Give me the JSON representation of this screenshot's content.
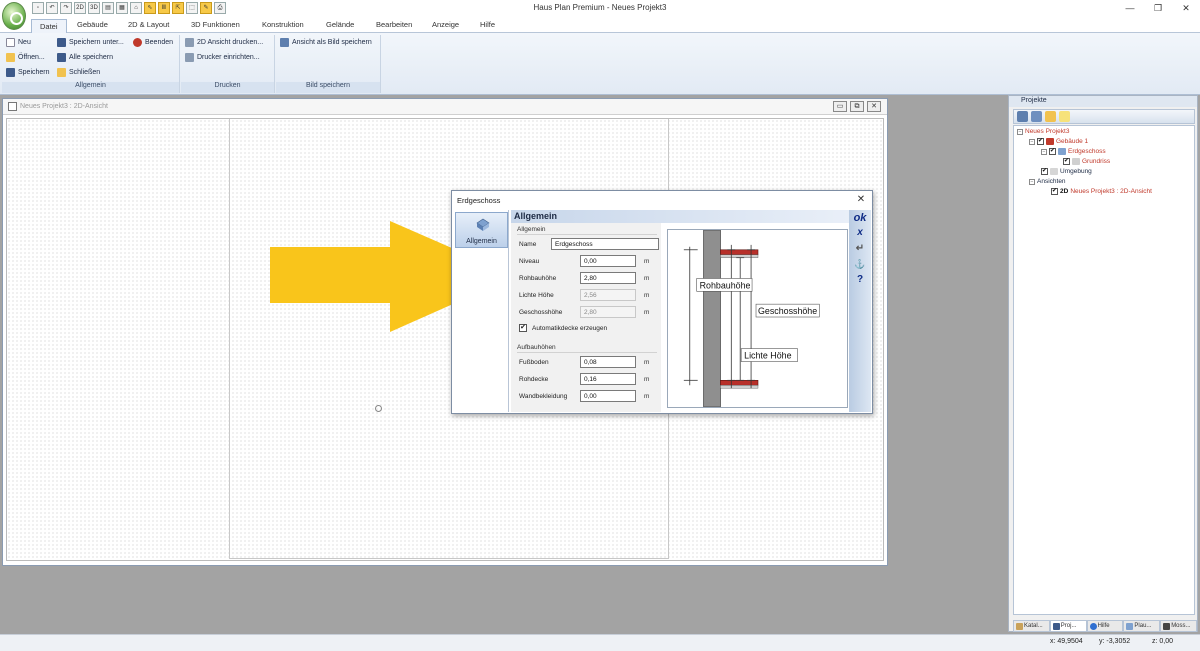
{
  "window": {
    "title": "Haus Plan Premium - Neues Projekt3",
    "controls": [
      "—",
      "❐",
      "✕"
    ]
  },
  "qat": [
    "2D",
    "3D",
    "▤",
    "▦",
    "⌂",
    "Ⅲ",
    "⇱",
    "⬚",
    "✎",
    "⎙"
  ],
  "ribbon": {
    "tabs": [
      "Datei",
      "Gebäude",
      "2D & Layout",
      "3D Funktionen",
      "Konstruktion",
      "Gelände",
      "Bearbeiten",
      "Anzeige",
      "Hilfe"
    ],
    "active_tab": "Datei",
    "groups": {
      "allgemein": {
        "label": "Allgemein",
        "items": [
          "Neu",
          "Öffnen...",
          "Speichern",
          "Speichern unter...",
          "Alle speichern",
          "Schließen",
          "Beenden"
        ]
      },
      "drucken": {
        "label": "Drucken",
        "items": [
          "2D Ansicht drucken...",
          "Drucker einrichten..."
        ]
      },
      "bild": {
        "label": "Bild speichern",
        "items": [
          "Ansicht als Bild speichern"
        ]
      }
    }
  },
  "view": {
    "title": "Neues Projekt3 : 2D-Ansicht",
    "controls": [
      "▭",
      "⧉",
      "✕"
    ]
  },
  "annotation": {
    "arrow_color": "#f9c51b"
  },
  "dialog": {
    "title": "Erdgeschoss",
    "close": "✕",
    "sidebar_item": "Allgemein",
    "header": "Allgemein",
    "section1": "Allgemein",
    "section2": "Aufbauhöhen",
    "fields": {
      "name": {
        "label": "Name",
        "value": "Erdgeschoss"
      },
      "niveau": {
        "label": "Niveau",
        "value": "0,00",
        "unit": "m"
      },
      "rohbauhoehe": {
        "label": "Rohbauhöhe",
        "value": "2,80",
        "unit": "m"
      },
      "lichte_hoehe": {
        "label": "Lichte Höhe",
        "value": "2,56",
        "unit": "m"
      },
      "geschosshoehe": {
        "label": "Geschosshöhe",
        "value": "2,80",
        "unit": "m"
      },
      "fussboden": {
        "label": "Fußboden",
        "value": "0,08",
        "unit": "m"
      },
      "rohdecke": {
        "label": "Rohdecke",
        "value": "0,16",
        "unit": "m"
      },
      "wandbekleidung": {
        "label": "Wandbekleidung",
        "value": "0,00",
        "unit": "m"
      }
    },
    "checkbox": {
      "label": "Automatikdecke erzeugen",
      "checked": true,
      "mark": "✔"
    },
    "buttons": {
      "ok": "ok",
      "cancel": "x",
      "apply": "↵",
      "anchor": "⚓",
      "help": "?"
    },
    "diagram_labels": {
      "rohbauhoehe": "Rohbauhöhe",
      "geschosshoehe": "Geschosshöhe",
      "lichte_hoehe": "Lichte Höhe"
    }
  },
  "projects": {
    "title": "Projekte",
    "tree": {
      "root": "Neues Projekt3",
      "gebaeude": "Gebäude 1",
      "erdgeschoss": "Erdgeschoss",
      "grundriss": "Grundriss",
      "umgebung": "Umgebung",
      "ansichten": "Ansichten",
      "view_prefix": "2D",
      "view": "Neues Projekt3 : 2D-Ansicht"
    },
    "tabs": [
      "Katal...",
      "Proj...",
      "Hilfe",
      "Plau...",
      "Moss..."
    ],
    "active_tab": "Proj..."
  },
  "status": {
    "x": "x: 49,9504",
    "y": "y: -3,3052",
    "z": "z: 0,00"
  }
}
